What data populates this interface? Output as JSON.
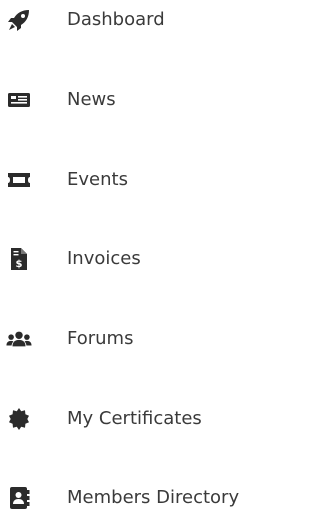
{
  "menu": {
    "items": [
      {
        "label": "Dashboard",
        "icon": "rocket-icon"
      },
      {
        "label": "News",
        "icon": "newspaper-icon"
      },
      {
        "label": "Events",
        "icon": "ticket-icon"
      },
      {
        "label": "Invoices",
        "icon": "invoice-icon"
      },
      {
        "label": "Forums",
        "icon": "users-icon"
      },
      {
        "label": "My Certificates",
        "icon": "certificate-icon"
      },
      {
        "label": "Members Directory",
        "icon": "address-book-icon"
      }
    ],
    "colors": {
      "icon": "#2b2b2b",
      "text": "#3a3a3a",
      "background": "#ffffff"
    }
  }
}
